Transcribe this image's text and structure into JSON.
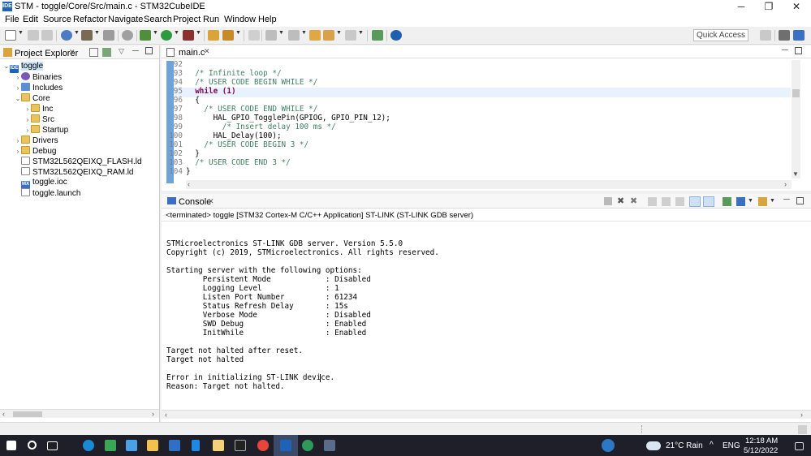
{
  "window": {
    "title": "STM - toggle/Core/Src/main.c - STM32CubeIDE",
    "app_icon_text": "IDE",
    "controls": {
      "minimize": "─",
      "maximize": "❐",
      "close": "✕"
    }
  },
  "menu": [
    "File",
    "Edit",
    "Source",
    "Refactor",
    "Navigate",
    "Search",
    "Project",
    "Run",
    "Window",
    "Help"
  ],
  "toolbar": {
    "quick_access": "Quick Access"
  },
  "explorer": {
    "tab": "Project Explorer",
    "tree": [
      {
        "label": "toggle",
        "twisty": "⌄",
        "icon": "ide"
      },
      {
        "label": "Binaries",
        "twisty": "›",
        "icon": "bin"
      },
      {
        "label": "Includes",
        "twisty": "›",
        "icon": "inc"
      },
      {
        "label": "Core",
        "twisty": "⌄",
        "icon": "folder"
      },
      {
        "label": "Inc",
        "twisty": "›",
        "icon": "folder"
      },
      {
        "label": "Src",
        "twisty": "›",
        "icon": "folder"
      },
      {
        "label": "Startup",
        "twisty": "›",
        "icon": "folder"
      },
      {
        "label": "Drivers",
        "twisty": "›",
        "icon": "folder"
      },
      {
        "label": "Debug",
        "twisty": "›",
        "icon": "folder"
      },
      {
        "label": "STM32L562QEIXQ_FLASH.ld",
        "twisty": "",
        "icon": "file"
      },
      {
        "label": "STM32L562QEIXQ_RAM.ld",
        "twisty": "",
        "icon": "file"
      },
      {
        "label": "toggle.ioc",
        "twisty": "",
        "icon": "mx"
      },
      {
        "label": "toggle.launch",
        "twisty": "",
        "icon": "file"
      }
    ]
  },
  "editor": {
    "tab": "main.c",
    "lines": [
      {
        "n": "92",
        "text": ""
      },
      {
        "n": "93",
        "text": "  /* Infinite loop */"
      },
      {
        "n": "94",
        "text": "  /* USER CODE BEGIN WHILE */"
      },
      {
        "n": "95",
        "text": "  while (1)"
      },
      {
        "n": "96",
        "text": "  {"
      },
      {
        "n": "97",
        "text": "    /* USER CODE END WHILE */"
      },
      {
        "n": "98",
        "text": "      HAL_GPIO_TogglePin(GPIOG, GPIO_PIN_12);"
      },
      {
        "n": "99",
        "text": "        /* Insert delay 100 ms */"
      },
      {
        "n": "100",
        "text": "      HAL_Delay(100);"
      },
      {
        "n": "101",
        "text": "    /* USER CODE BEGIN 3 */"
      },
      {
        "n": "102",
        "text": "  }"
      },
      {
        "n": "103",
        "text": "  /* USER CODE END 3 */"
      },
      {
        "n": "104",
        "text": "}"
      }
    ]
  },
  "console": {
    "tab": "Console",
    "status": "<terminated> toggle [STM32 Cortex-M C/C++ Application] ST-LINK (ST-LINK GDB server)",
    "lines": [
      "",
      "",
      "STMicroelectronics ST-LINK GDB server. Version 5.5.0",
      "Copyright (c) 2019, STMicroelectronics. All rights reserved.",
      "",
      "Starting server with the following options:",
      "        Persistent Mode            : Disabled",
      "        Logging Level              : 1",
      "        Listen Port Number         : 61234",
      "        Status Refresh Delay       : 15s",
      "        Verbose Mode               : Disabled",
      "        SWD Debug                  : Enabled",
      "        InitWhile                  : Enabled",
      "",
      "Target not halted after reset.",
      "Target not halted",
      "",
      "Error in initializing ST-LINK device.",
      "Reason: Target not halted."
    ]
  },
  "taskbar": {
    "weather": "21°C  Rain",
    "language": "ENG",
    "time": "12:18 AM",
    "date": "5/12/2022",
    "chevron": "^"
  }
}
